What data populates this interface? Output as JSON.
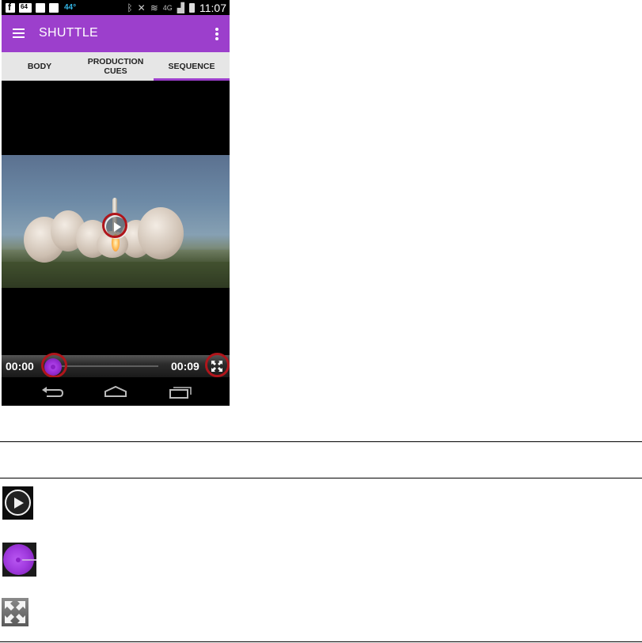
{
  "statusbar": {
    "temperature": "44°",
    "time": "11:07",
    "network": "4G"
  },
  "appbar": {
    "title": "SHUTTLE"
  },
  "tabs": [
    {
      "label": "BODY",
      "active": false
    },
    {
      "label": "PRODUCTION CUES",
      "active": false
    },
    {
      "label": "SEQUENCE",
      "active": true
    }
  ],
  "player": {
    "current_time": "00:00",
    "duration": "00:09",
    "progress": 0
  },
  "colors": {
    "accent": "#9c3fcc",
    "annotation_ring": "#b0151b"
  },
  "legend": [
    {
      "icon": "play-icon"
    },
    {
      "icon": "seek-knob-icon"
    },
    {
      "icon": "fullscreen-icon"
    }
  ]
}
